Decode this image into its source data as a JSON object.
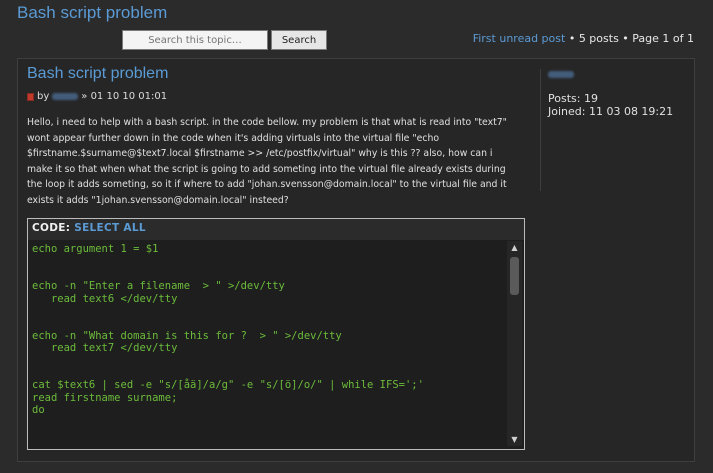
{
  "topic": {
    "title": "Bash script problem"
  },
  "search": {
    "placeholder": "Search this topic…",
    "button_label": "Search"
  },
  "pagination": {
    "first_unread_label": "First unread post",
    "summary": "• 5 posts • Page 1 of 1"
  },
  "post": {
    "title": "Bash script problem",
    "by_label": "by",
    "date": "» 01 10 10 01:01",
    "body": "Hello, i need to help with a bash script. in the code bellow. my problem is that what is read into \"text7\" wont appear further down in the code when it's adding virtuals into the virtual file \"echo $firstname.$surname@$text7.local $firstname >> /etc/postfix/virtual\" why is this ?? also, how can i make it so that when what the script is going to add someting into the virtual file already exists during the loop it adds someting, so it if where to add \"johan.svensson@domain.local\" to the virtual file and it exists it adds \"1johan.svensson@domain.local\" insteed?"
  },
  "profile": {
    "posts": "Posts: 19",
    "joined": "Joined: 11 03 08 19:21"
  },
  "code": {
    "header_label": "CODE:",
    "select_all_label": "SELECT ALL",
    "lines": [
      "echo argument 1 = $1",
      "",
      "",
      "echo -n \"Enter a filename  > \" >/dev/tty",
      "   read text6 </dev/tty",
      "",
      "",
      "echo -n \"What domain is this for ?  > \" >/dev/tty",
      "   read text7 </dev/tty",
      "",
      "",
      "cat $text6 | sed -e \"s/[åä]/a/g\" -e \"s/[ö]/o/\" | while IFS=';'",
      "read firstname surname;",
      "do"
    ]
  },
  "icons": {
    "post_icon": "post-icon",
    "scroll_up": "scroll-up-arrow-icon",
    "scroll_down": "scroll-down-arrow-icon"
  },
  "colors": {
    "link": "#5b9bd5",
    "code_text": "#6cbc3b",
    "background": "#2b2b2b"
  }
}
